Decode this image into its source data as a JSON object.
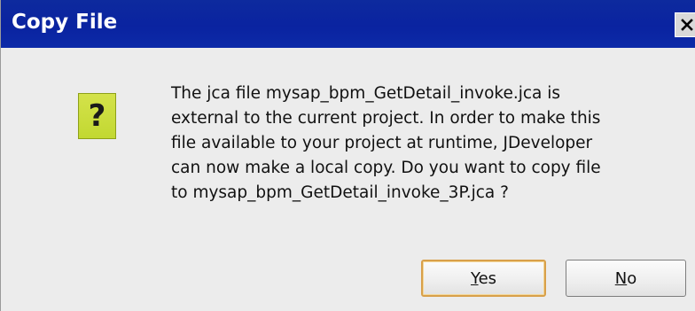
{
  "window": {
    "title": "Copy File",
    "close_icon": "close-icon"
  },
  "icon": {
    "name": "question-icon",
    "glyph": "?",
    "color": "#c8dc3a"
  },
  "message": {
    "lines": [
      "The jca file mysap_bpm_GetDetail_invoke.jca is",
      "external to the current project. In order to make this",
      "file available to your project at runtime, JDeveloper",
      "can now make a local copy. Do you want to copy file",
      "to mysap_bpm_GetDetail_invoke_3P.jca ?"
    ]
  },
  "buttons": {
    "yes": {
      "mnemonic": "Y",
      "rest": "es"
    },
    "no": {
      "mnemonic": "N",
      "rest": "o"
    }
  },
  "colors": {
    "titlebar": "#0a23a0",
    "dialog_bg": "#ececec",
    "default_button_border": "#d8a04a"
  }
}
